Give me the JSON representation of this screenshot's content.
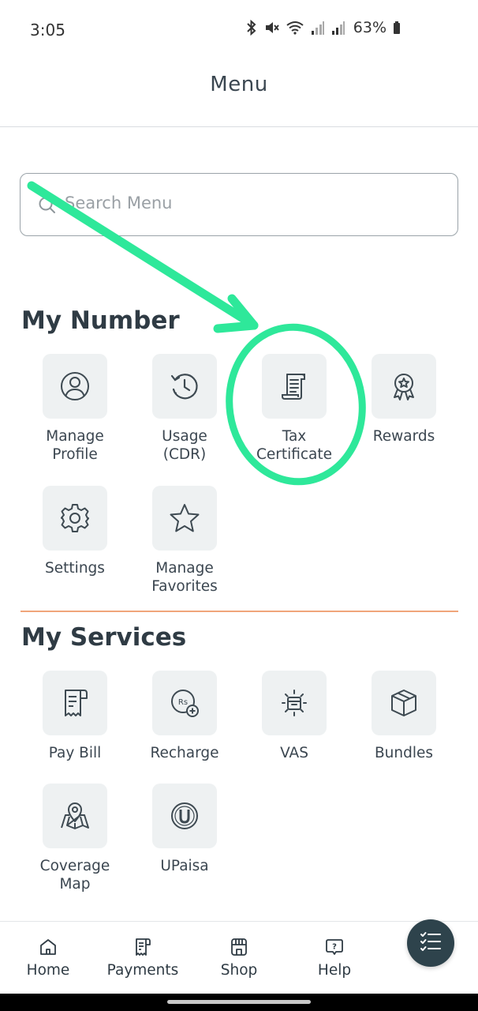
{
  "status_bar": {
    "time": "3:05",
    "battery": "63%",
    "icons": [
      "bluetooth-icon",
      "mute-icon",
      "wifi-icon",
      "signal-icon",
      "signal-icon",
      "battery-icon"
    ]
  },
  "header": {
    "title": "Menu"
  },
  "search": {
    "placeholder": "Search Menu",
    "icon": "search-icon"
  },
  "sections": [
    {
      "title": "My Number",
      "items": [
        {
          "label": "Manage\nProfile",
          "icon": "user-circle-icon"
        },
        {
          "label": "Usage\n(CDR)",
          "icon": "history-clock-icon"
        },
        {
          "label": "Tax\nCertificate",
          "icon": "scroll-document-icon"
        },
        {
          "label": "Rewards",
          "icon": "award-badge-icon"
        },
        {
          "label": "Settings",
          "icon": "gear-icon"
        },
        {
          "label": "Manage\nFavorites",
          "icon": "star-icon"
        }
      ]
    },
    {
      "title": "My Services",
      "items": [
        {
          "label": "Pay Bill",
          "icon": "bill-receipt-icon"
        },
        {
          "label": "Recharge",
          "icon": "rupee-plus-icon"
        },
        {
          "label": "VAS",
          "icon": "vas-icon"
        },
        {
          "label": "Bundles",
          "icon": "box-icon"
        },
        {
          "label": "Coverage\nMap",
          "icon": "map-pin-icon"
        },
        {
          "label": "UPaisa",
          "icon": "upaisa-icon"
        }
      ]
    }
  ],
  "bottom_nav": [
    {
      "label": "Home",
      "icon": "home-icon"
    },
    {
      "label": "Payments",
      "icon": "payments-icon"
    },
    {
      "label": "Shop",
      "icon": "shop-icon"
    },
    {
      "label": "Help",
      "icon": "help-icon"
    }
  ],
  "fab": {
    "icon": "checklist-icon"
  },
  "colors": {
    "accent_annotation": "#2ee89a",
    "divider": "#f0a57a",
    "tile_bg": "#eef1f2",
    "text": "#2f3b44",
    "fab_bg": "#2e434c"
  }
}
